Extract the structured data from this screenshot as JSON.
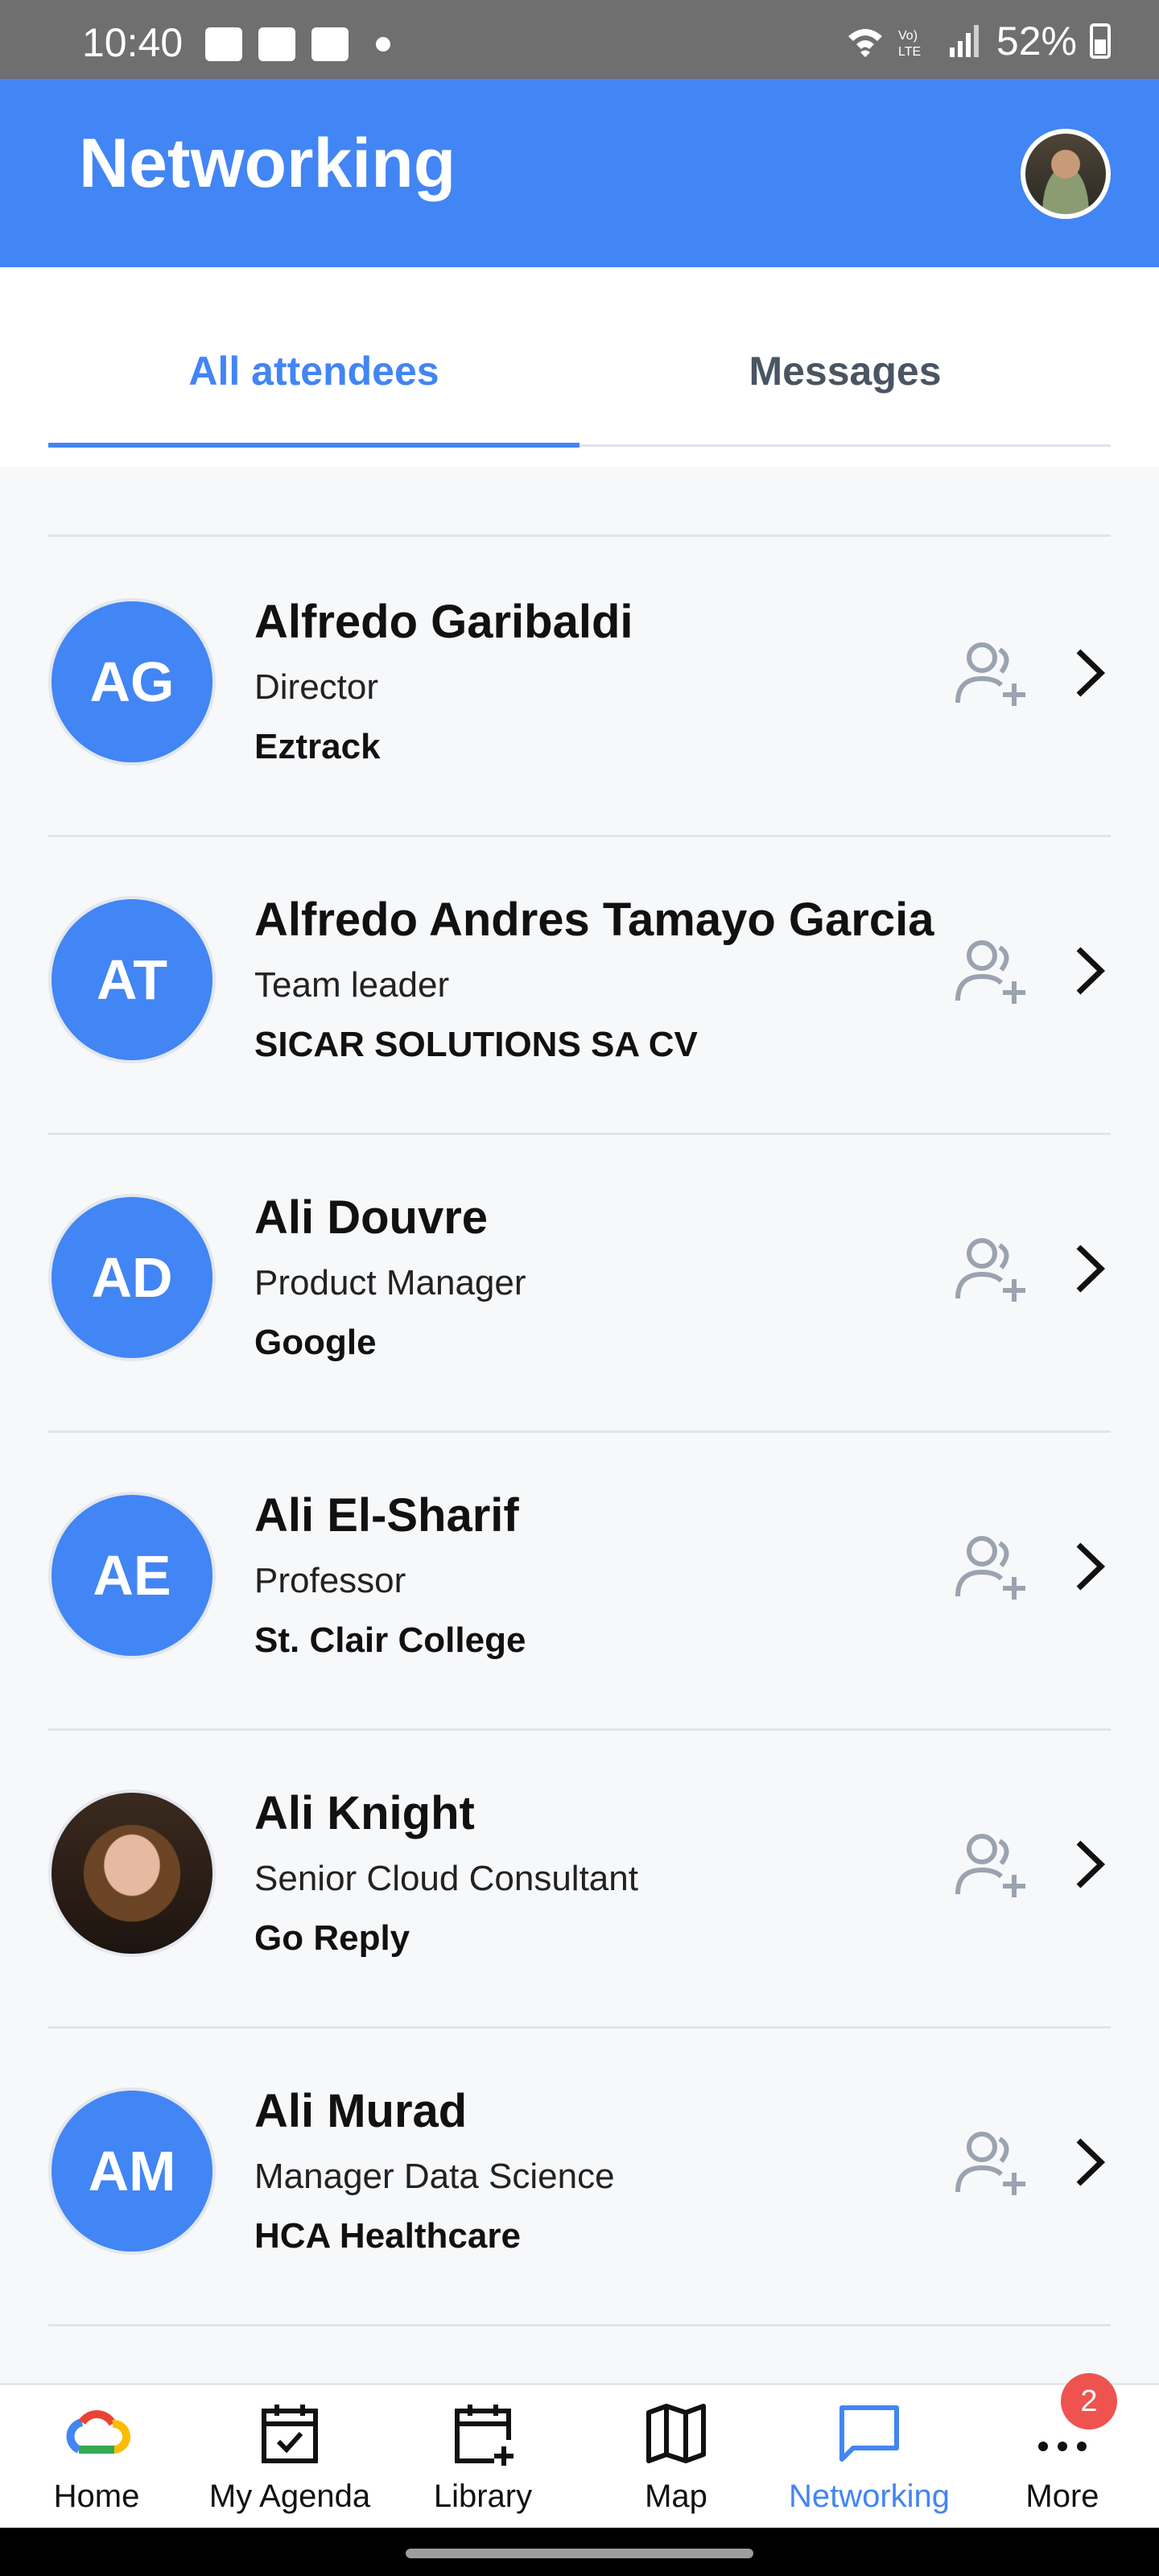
{
  "status_bar": {
    "time": "10:40",
    "battery": "52%"
  },
  "app_bar": {
    "title": "Networking"
  },
  "tabs": [
    {
      "label": "All attendees",
      "active": true
    },
    {
      "label": "Messages",
      "active": false
    }
  ],
  "attendees": [
    {
      "initials": "AG",
      "name": "Alfredo Garibaldi",
      "title": "Director",
      "company": "Eztrack"
    },
    {
      "initials": "AT",
      "name": "Alfredo Andres Tamayo Garcia",
      "title": "Team leader",
      "company": "SICAR SOLUTIONS SA CV"
    },
    {
      "initials": "AD",
      "name": "Ali Douvre",
      "title": "Product Manager",
      "company": "Google"
    },
    {
      "initials": "AE",
      "name": "Ali El-Sharif",
      "title": "Professor",
      "company": "St. Clair College"
    },
    {
      "initials": "",
      "name": "Ali Knight",
      "title": "Senior Cloud Consultant",
      "company": "Go Reply"
    },
    {
      "initials": "AM",
      "name": "Ali Murad",
      "title": "Manager Data Science",
      "company": "HCA Healthcare"
    }
  ],
  "bottom_nav": [
    {
      "label": "Home",
      "icon": "google-cloud-icon"
    },
    {
      "label": "My Agenda",
      "icon": "calendar-check-icon"
    },
    {
      "label": "Library",
      "icon": "calendar-plus-icon"
    },
    {
      "label": "Map",
      "icon": "map-icon"
    },
    {
      "label": "Networking",
      "icon": "chat-icon",
      "active": true
    },
    {
      "label": "More",
      "icon": "more-icon"
    }
  ],
  "more_badge": "2",
  "colors": {
    "primary": "#4285f4",
    "badge": "#ef5350",
    "muted_icon": "#9aa3af"
  }
}
